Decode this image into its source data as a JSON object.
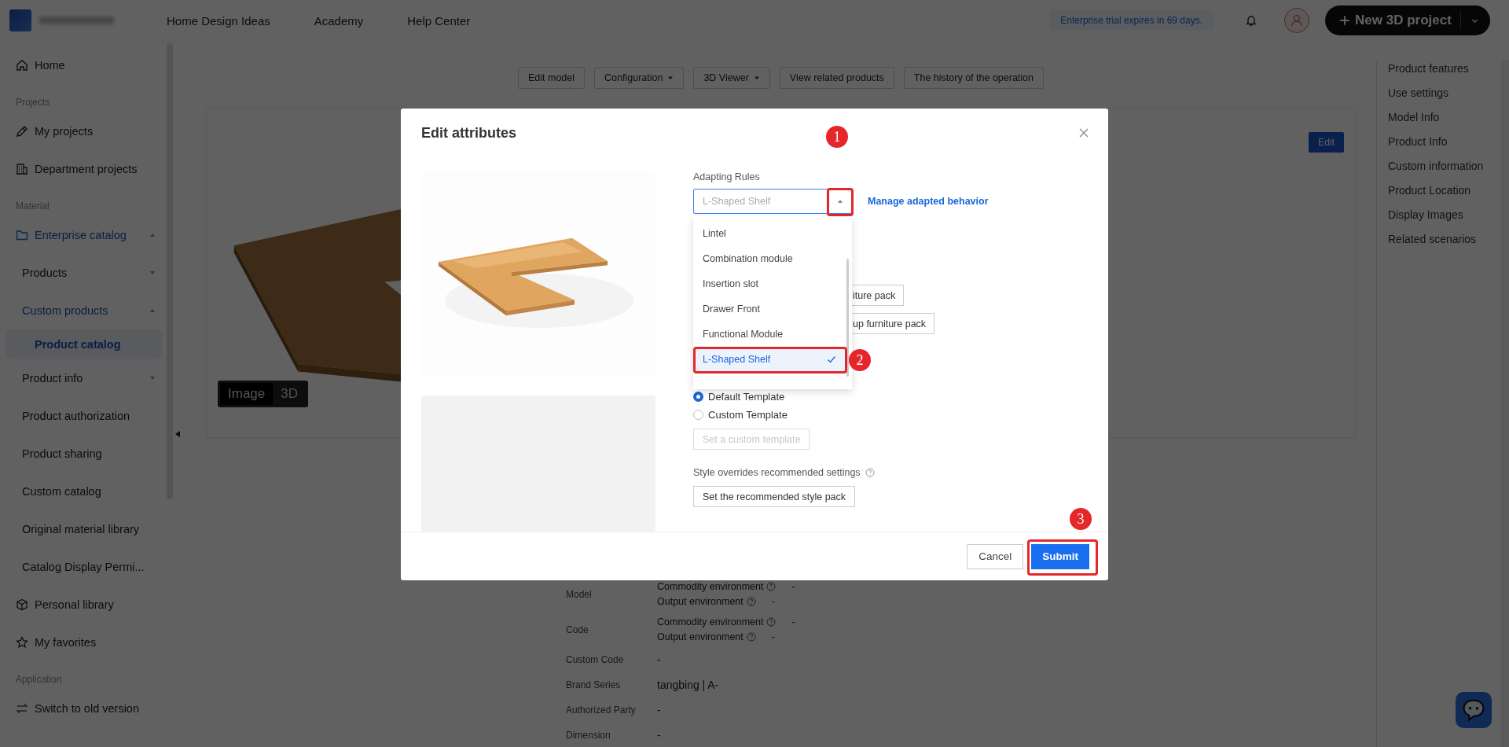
{
  "header": {
    "nav": [
      "Home Design Ideas",
      "Academy",
      "Help Center"
    ],
    "trial_notice": "Enterprise trial expires in 69 days.",
    "new_project_button": "New 3D project"
  },
  "sidebar": {
    "sections": [
      {
        "items": [
          {
            "label": "Home",
            "selected": false
          }
        ]
      },
      {
        "title": "Projects",
        "items": [
          {
            "label": "My projects",
            "selected": false
          },
          {
            "label": "Department projects",
            "selected": false
          }
        ]
      },
      {
        "title": "Material",
        "items": [
          {
            "label": "Enterprise catalog",
            "selected": false,
            "expanded": true,
            "children": [
              {
                "label": "Products",
                "selected": false,
                "expanded": false
              },
              {
                "label": "Custom products",
                "selected": false,
                "expanded": true,
                "children": [
                  {
                    "label": "Product catalog",
                    "selected": true
                  }
                ]
              },
              {
                "label": "Product info",
                "selected": false,
                "expanded": false
              },
              {
                "label": "Product authorization",
                "selected": false
              },
              {
                "label": "Product sharing",
                "selected": false
              },
              {
                "label": "Custom catalog",
                "selected": false
              },
              {
                "label": "Original material library",
                "selected": false
              },
              {
                "label": "Catalog Display Permi...",
                "selected": false
              }
            ]
          },
          {
            "label": "Personal library",
            "selected": false
          },
          {
            "label": "My favorites",
            "selected": false
          }
        ]
      },
      {
        "title": "Application",
        "items": [
          {
            "label": "Switch to old version",
            "selected": false
          }
        ]
      }
    ]
  },
  "toolbar": [
    {
      "label": "Edit model",
      "dropdown": false
    },
    {
      "label": "Configuration",
      "dropdown": true
    },
    {
      "label": "3D Viewer",
      "dropdown": true
    },
    {
      "label": "View related products",
      "dropdown": false
    },
    {
      "label": "The history of the operation",
      "dropdown": false
    }
  ],
  "card": {
    "edit_button": "Edit",
    "view_toggle": [
      {
        "label": "Image",
        "selected": true
      },
      {
        "label": "3D",
        "selected": false
      }
    ]
  },
  "details": [
    {
      "label": "Model",
      "environments": [
        {
          "name": "Commodity environment",
          "value": "-"
        },
        {
          "name": "Output environment",
          "value": "-"
        }
      ]
    },
    {
      "label": "Code",
      "environments": [
        {
          "name": "Commodity environment",
          "value": "-"
        },
        {
          "name": "Output environment",
          "value": "-"
        }
      ]
    },
    {
      "label": "Custom Code",
      "value": "-"
    },
    {
      "label": "Brand Series",
      "value": "tangbing | A-"
    },
    {
      "label": "Authorized Party",
      "value": "-"
    },
    {
      "label": "Dimension",
      "value": "-"
    }
  ],
  "right_nav": [
    "Product features",
    "Use settings",
    "Model Info",
    "Product Info",
    "Custom information",
    "Product Location",
    "Display Images",
    "Related scenarios"
  ],
  "modal": {
    "title": "Edit attributes",
    "adapting_rules": {
      "label": "Adapting Rules",
      "placeholder": "L-Shaped Shelf",
      "expanded": true,
      "link": "Manage adapted behavior",
      "options": [
        {
          "label": "Lintel",
          "selected": false
        },
        {
          "label": "Combination module",
          "selected": false
        },
        {
          "label": "Insertion slot",
          "selected": false
        },
        {
          "label": "Drawer Front",
          "selected": false
        },
        {
          "label": "Functional Module",
          "selected": false
        },
        {
          "label": "L-Shaped Shelf",
          "selected": true
        }
      ]
    },
    "pack_buttons": [
      "iture pack",
      "up furniture pack"
    ],
    "templates": [
      {
        "label": "Default Template",
        "selected": true
      },
      {
        "label": "Custom Template",
        "selected": false
      }
    ],
    "custom_template_button": {
      "label": "Set a custom template",
      "disabled": true
    },
    "style_label": "Style overrides recommended settings",
    "style_button": "Set the recommended style pack",
    "cancel": "Cancel",
    "submit": "Submit"
  },
  "annotations": [
    {
      "label": "1"
    },
    {
      "label": "2"
    },
    {
      "label": "3"
    }
  ]
}
